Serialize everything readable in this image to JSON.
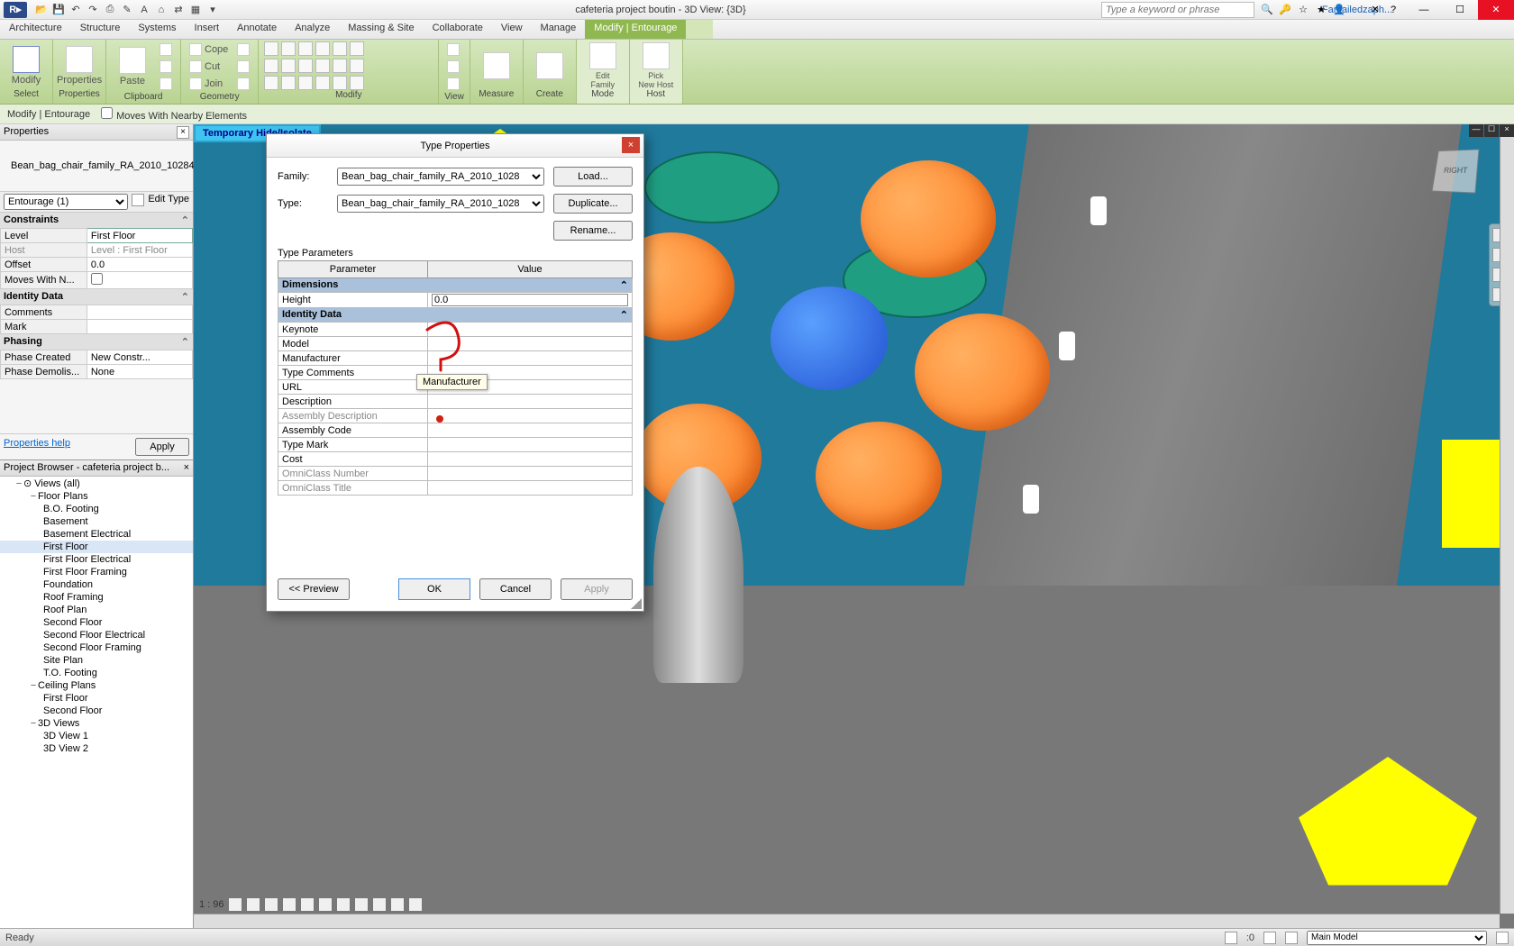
{
  "titlebar": {
    "title": "cafeteria project boutin - 3D View: {3D}",
    "search_placeholder": "Type a keyword or phrase",
    "user": "Fantailedzaph..."
  },
  "ribbon_tabs": [
    "Architecture",
    "Structure",
    "Systems",
    "Insert",
    "Annotate",
    "Analyze",
    "Massing & Site",
    "Collaborate",
    "View",
    "Manage",
    "Modify | Entourage"
  ],
  "ribbon": {
    "select": "Select",
    "properties": "Properties",
    "modify": "Modify",
    "clipboard": "Clipboard",
    "paste": "Paste",
    "cope": "Cope",
    "cut": "Cut",
    "join": "Join",
    "geometry": "Geometry",
    "modify_group": "Modify",
    "view": "View",
    "measure": "Measure",
    "create": "Create",
    "edit_family": "Edit\nFamily",
    "pick_new_host": "Pick\nNew Host",
    "mode": "Mode",
    "host": "Host"
  },
  "options": {
    "context": "Modify | Entourage",
    "checkbox": "Moves With Nearby Elements"
  },
  "properties": {
    "title": "Properties",
    "type_name": "Bean_bag_chair_family_RA_2010_10284",
    "selector": "Entourage (1)",
    "edit_type": "Edit Type",
    "sections": {
      "constraints": "Constraints",
      "identity": "Identity Data",
      "phasing": "Phasing"
    },
    "rows": {
      "level_lbl": "Level",
      "level_val": "First Floor",
      "host_lbl": "Host",
      "host_val": "Level : First Floor",
      "offset_lbl": "Offset",
      "offset_val": "0.0",
      "moves_lbl": "Moves With N...",
      "comments_lbl": "Comments",
      "mark_lbl": "Mark",
      "phase_created_lbl": "Phase Created",
      "phase_created_val": "New Constr...",
      "phase_demolished_lbl": "Phase Demolis...",
      "phase_demolished_val": "None"
    },
    "help": "Properties help",
    "apply": "Apply"
  },
  "browser": {
    "title": "Project Browser - cafeteria project b...",
    "views": "Views (all)",
    "floor_plans": "Floor Plans",
    "items_fp": [
      "B.O. Footing",
      "Basement",
      "Basement Electrical",
      "First Floor",
      "First Floor Electrical",
      "First Floor Framing",
      "Foundation",
      "Roof Framing",
      "Roof Plan",
      "Second Floor",
      "Second Floor Electrical",
      "Second Floor Framing",
      "Site Plan",
      "T.O. Footing"
    ],
    "ceiling_plans": "Ceiling Plans",
    "items_cp": [
      "First Floor",
      "Second Floor"
    ],
    "threed": "3D Views",
    "items_3d": [
      "3D View 1",
      "3D View 2"
    ]
  },
  "viewport": {
    "temp_hide": "Temporary Hide/Isolate",
    "viewcube_face": "RIGHT",
    "scale": "1 : 96"
  },
  "dialog": {
    "title": "Type Properties",
    "family_lbl": "Family:",
    "family_val": "Bean_bag_chair_family_RA_2010_1028",
    "type_lbl": "Type:",
    "type_val": "Bean_bag_chair_family_RA_2010_1028",
    "load": "Load...",
    "duplicate": "Duplicate...",
    "rename": "Rename...",
    "type_params": "Type Parameters",
    "col_param": "Parameter",
    "col_value": "Value",
    "cat_dimensions": "Dimensions",
    "height_lbl": "Height",
    "height_val": "0.0",
    "cat_identity": "Identity Data",
    "keynote": "Keynote",
    "model": "Model",
    "manufacturer": "Manufacturer",
    "type_comments": "Type Comments",
    "url": "URL",
    "description": "Description",
    "assembly_desc": "Assembly Description",
    "assembly_code": "Assembly Code",
    "type_mark": "Type Mark",
    "cost": "Cost",
    "omni_num": "OmniClass Number",
    "omni_title": "OmniClass Title",
    "tooltip": "Manufacturer",
    "preview": "<< Preview",
    "ok": "OK",
    "cancel": "Cancel",
    "apply": "Apply"
  },
  "status": {
    "ready": "Ready",
    "sel_count": ":0",
    "main_model": "Main Model"
  }
}
